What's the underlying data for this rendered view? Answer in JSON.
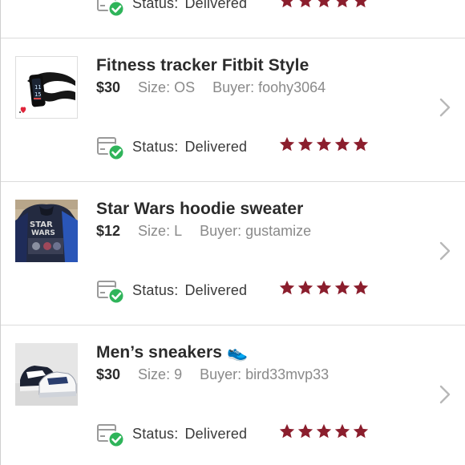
{
  "listings": [
    {
      "title": "",
      "price": "",
      "size": "",
      "buyer": "",
      "status_label": "Status:",
      "status_value": "Delivered",
      "rating": 5,
      "thumb": "none"
    },
    {
      "title": "Fitness tracker Fitbit Style",
      "price": "$30",
      "size": "Size: OS",
      "buyer": "Buyer: foohy3064",
      "status_label": "Status:",
      "status_value": "Delivered",
      "rating": 5,
      "thumb": "fitness-tracker"
    },
    {
      "title": "Star Wars hoodie sweater",
      "price": "$12",
      "size": "Size: L",
      "buyer": "Buyer: gustamize",
      "status_label": "Status:",
      "status_value": "Delivered",
      "rating": 5,
      "thumb": "hoodie"
    },
    {
      "title": "Men’s sneakers 👟",
      "price": "$30",
      "size": "Size: 9",
      "buyer": "Buyer: bird33mvp33",
      "status_label": "Status:",
      "status_value": "Delivered",
      "rating": 5,
      "thumb": "sneakers"
    }
  ],
  "colors": {
    "star": "#8b1e2d",
    "check": "#2fb45a",
    "chevron": "#b8b8b8"
  },
  "icons": {
    "status": "delivered-box-icon",
    "rating": "star-icon",
    "chevron": "chevron-right-icon"
  }
}
